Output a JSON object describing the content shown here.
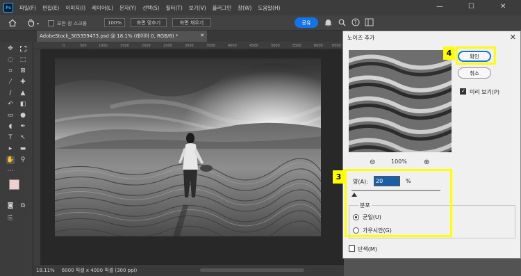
{
  "app": {
    "logo": "Ps"
  },
  "menu": [
    "파일(F)",
    "편집(E)",
    "이미지(I)",
    "레이어(L)",
    "문자(Y)",
    "선택(S)",
    "필터(T)",
    "보기(V)",
    "플러그인",
    "창(W)",
    "도움말(H)"
  ],
  "window_controls": {
    "minimize": "—",
    "maximize": "☐",
    "close": "✕"
  },
  "options": {
    "home_icon": "home-icon",
    "hand_icon": "hand-icon",
    "scroll_all": "모든 창 스크롤",
    "zoom": "100%",
    "fit_screen": "화면 맞추기",
    "fill_screen": "화면 채우기",
    "share": "공유"
  },
  "document": {
    "tab": "AdobeStock_305359473.psd @ 18.1% (레이어 0, RGB/8) *",
    "close": "✕",
    "zoom_status": "18.11%",
    "size_status": "6000 픽셀 x 4000 픽셀 (300 ppi)"
  },
  "ruler_labels": [
    "0",
    "500",
    "1000",
    "1500",
    "2000",
    "2500",
    "3000",
    "3500",
    "4000",
    "4500",
    "5000",
    "5500",
    "6000",
    "6500",
    "7000"
  ],
  "dialog": {
    "title": "노이즈 추가",
    "close": "✕",
    "ok": "확인",
    "cancel": "취소",
    "preview_label": "미리 보기(P)",
    "preview_checked": true,
    "zoom_out": "⊖",
    "zoom_level": "100%",
    "zoom_in": "⊕",
    "amount_label": "양(A):",
    "amount_value": "20",
    "amount_unit": "%",
    "distribution_label": "분포",
    "uniform": "균일(U)",
    "gaussian": "가우시안(G)",
    "uniform_selected": true,
    "monochromatic": "단색(M)",
    "monochromatic_checked": false
  },
  "callouts": {
    "step3": "3",
    "step4": "4"
  },
  "colors": {
    "accent": "#1473e6",
    "callout": "#ffff00",
    "foreground": "#f2cfcf",
    "background": "#ffffff"
  }
}
